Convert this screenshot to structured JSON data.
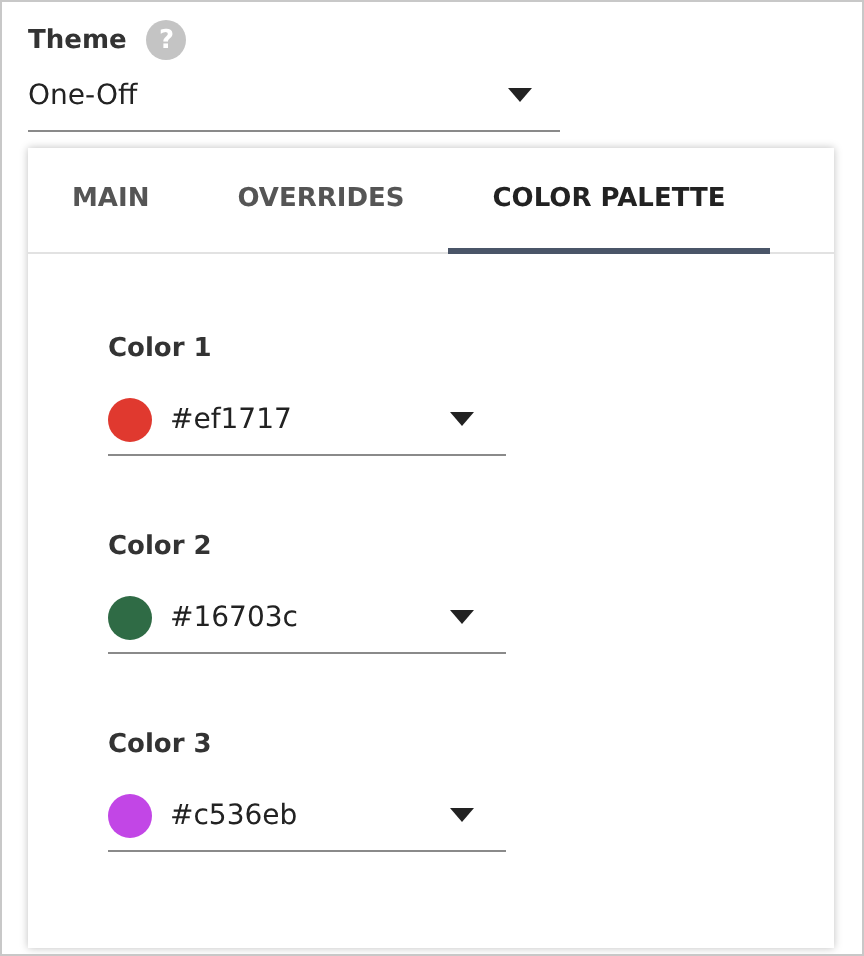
{
  "theme": {
    "label": "Theme",
    "help": "?",
    "value": "One-Off"
  },
  "tabs": [
    {
      "label": "MAIN",
      "selected": false
    },
    {
      "label": "OVERRIDES",
      "selected": false
    },
    {
      "label": "COLOR PALETTE",
      "selected": true
    }
  ],
  "colors": [
    {
      "label": "Color 1",
      "value": "#ef1717",
      "color": "#e0392f"
    },
    {
      "label": "Color 2",
      "value": "#16703c",
      "color": "#2f6b45"
    },
    {
      "label": "Color 3",
      "value": "#c536eb",
      "color": "#c246e6"
    }
  ]
}
